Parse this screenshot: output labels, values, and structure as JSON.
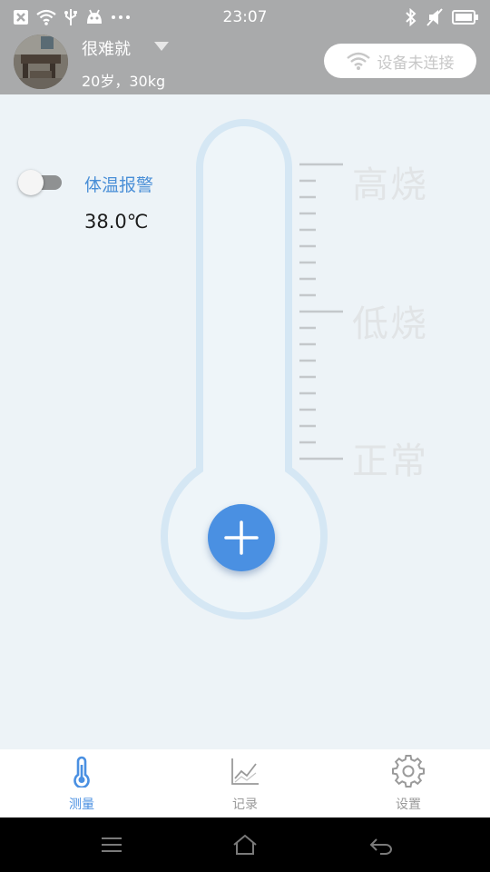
{
  "status_bar": {
    "time": "23:07",
    "left_icons": [
      "close-box-icon",
      "wifi-icon",
      "usb-icon",
      "android-icon",
      "more-dots-icon"
    ],
    "right_icons": [
      "bluetooth-icon",
      "mute-icon",
      "battery-icon"
    ]
  },
  "header": {
    "user_name": "很难就",
    "user_info": "20岁，30kg",
    "connect_status": "设备未连接"
  },
  "alarm": {
    "label": "体温报警",
    "value": "38.0℃",
    "enabled": false
  },
  "thermometer": {
    "scale_labels": {
      "high": "高烧",
      "low": "低烧",
      "normal": "正常"
    }
  },
  "tabs": [
    {
      "label": "测量",
      "icon": "thermometer-icon",
      "active": true
    },
    {
      "label": "记录",
      "icon": "chart-icon",
      "active": false
    },
    {
      "label": "设置",
      "icon": "gear-icon",
      "active": false
    }
  ],
  "colors": {
    "accent": "#4a90e2",
    "header_bg": "#a9aaab",
    "background": "#edf3f7",
    "inactive_tab": "#9a9a9a"
  }
}
